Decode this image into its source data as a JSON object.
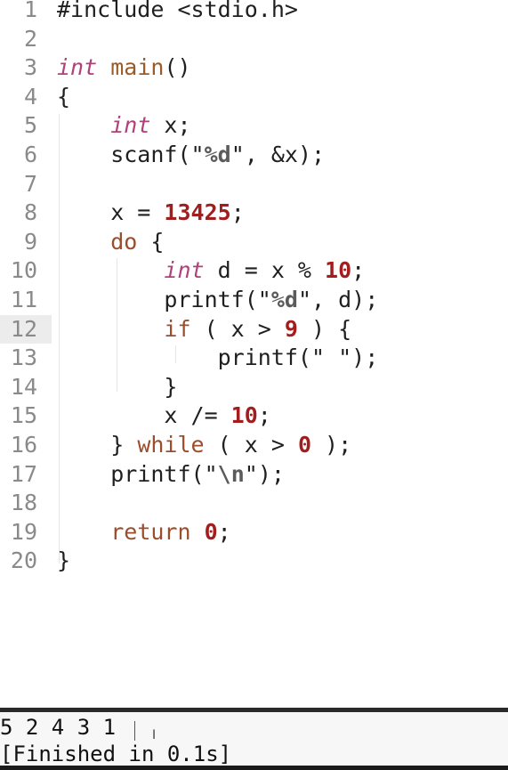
{
  "editor": {
    "current_line": 12,
    "lines": [
      {
        "n": "1",
        "tokens": [
          {
            "t": "#include <stdio.h>",
            "c": "pre"
          }
        ]
      },
      {
        "n": "2",
        "tokens": []
      },
      {
        "n": "3",
        "tokens": [
          {
            "t": "int",
            "c": "type"
          },
          {
            "t": " ",
            "c": "p"
          },
          {
            "t": "main",
            "c": "fn"
          },
          {
            "t": "()",
            "c": "p"
          }
        ]
      },
      {
        "n": "4",
        "tokens": [
          {
            "t": "{",
            "c": "p"
          }
        ]
      },
      {
        "n": "5",
        "tokens": [
          {
            "t": "    ",
            "c": "p"
          },
          {
            "t": "int",
            "c": "type"
          },
          {
            "t": " x;",
            "c": "p"
          }
        ]
      },
      {
        "n": "6",
        "tokens": [
          {
            "t": "    scanf(",
            "c": "p"
          },
          {
            "t": "\"",
            "c": "str"
          },
          {
            "t": "%d",
            "c": "esc"
          },
          {
            "t": "\"",
            "c": "str"
          },
          {
            "t": ", &x);",
            "c": "p"
          }
        ]
      },
      {
        "n": "7",
        "tokens": []
      },
      {
        "n": "8",
        "tokens": [
          {
            "t": "    x = ",
            "c": "p"
          },
          {
            "t": "13425",
            "c": "num"
          },
          {
            "t": ";",
            "c": "p"
          }
        ]
      },
      {
        "n": "9",
        "tokens": [
          {
            "t": "    ",
            "c": "p"
          },
          {
            "t": "do",
            "c": "kw"
          },
          {
            "t": " {",
            "c": "p"
          }
        ]
      },
      {
        "n": "10",
        "tokens": [
          {
            "t": "        ",
            "c": "p"
          },
          {
            "t": "int",
            "c": "type"
          },
          {
            "t": " d = x % ",
            "c": "p"
          },
          {
            "t": "10",
            "c": "num"
          },
          {
            "t": ";",
            "c": "p"
          }
        ]
      },
      {
        "n": "11",
        "tokens": [
          {
            "t": "        printf(",
            "c": "p"
          },
          {
            "t": "\"",
            "c": "str"
          },
          {
            "t": "%d",
            "c": "esc"
          },
          {
            "t": "\"",
            "c": "str"
          },
          {
            "t": ", d);",
            "c": "p"
          }
        ]
      },
      {
        "n": "12",
        "tokens": [
          {
            "t": "        ",
            "c": "p"
          },
          {
            "t": "if",
            "c": "kw"
          },
          {
            "t": " ( x > ",
            "c": "p"
          },
          {
            "t": "9",
            "c": "num"
          },
          {
            "t": " ) {",
            "c": "p"
          }
        ]
      },
      {
        "n": "13",
        "tokens": [
          {
            "t": "            printf(",
            "c": "p"
          },
          {
            "t": "\" \"",
            "c": "str"
          },
          {
            "t": ");",
            "c": "p"
          }
        ]
      },
      {
        "n": "14",
        "tokens": [
          {
            "t": "        }",
            "c": "p"
          }
        ]
      },
      {
        "n": "15",
        "tokens": [
          {
            "t": "        x /= ",
            "c": "p"
          },
          {
            "t": "10",
            "c": "num"
          },
          {
            "t": ";",
            "c": "p"
          }
        ]
      },
      {
        "n": "16",
        "tokens": [
          {
            "t": "    } ",
            "c": "p"
          },
          {
            "t": "while",
            "c": "kw"
          },
          {
            "t": " ( x > ",
            "c": "p"
          },
          {
            "t": "0",
            "c": "num"
          },
          {
            "t": " );",
            "c": "p"
          }
        ]
      },
      {
        "n": "17",
        "tokens": [
          {
            "t": "    printf(",
            "c": "p"
          },
          {
            "t": "\"",
            "c": "str"
          },
          {
            "t": "\\n",
            "c": "esc"
          },
          {
            "t": "\"",
            "c": "str"
          },
          {
            "t": ");",
            "c": "p"
          }
        ]
      },
      {
        "n": "18",
        "tokens": []
      },
      {
        "n": "19",
        "tokens": [
          {
            "t": "    ",
            "c": "p"
          },
          {
            "t": "return",
            "c": "kw"
          },
          {
            "t": " ",
            "c": "p"
          },
          {
            "t": "0",
            "c": "num"
          },
          {
            "t": ";",
            "c": "p"
          }
        ]
      },
      {
        "n": "20",
        "tokens": [
          {
            "t": "}",
            "c": "p"
          }
        ]
      }
    ]
  },
  "console": {
    "output_line": "5 2 4 3 1",
    "status_line": "[Finished in 0.1s]"
  }
}
